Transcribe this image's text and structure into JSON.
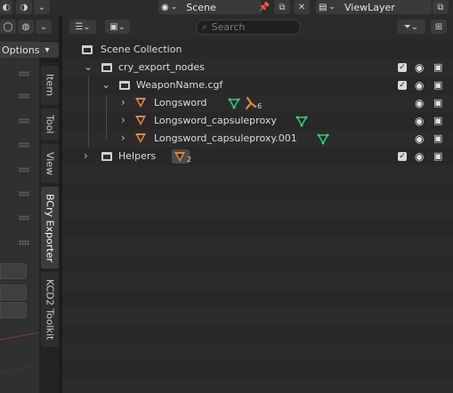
{
  "topbar": {
    "scene_label": "Scene",
    "viewlayer_label": "ViewLayer"
  },
  "viewport": {
    "options_label": "Options",
    "options_arrow": "▾"
  },
  "sidebar_tabs": [
    "Item",
    "Tool",
    "View",
    "BCry Exporter",
    "KCD2 Toolkit"
  ],
  "outliner": {
    "search_placeholder": "Search",
    "rows": [
      {
        "label": "Scene Collection"
      },
      {
        "label": "cry_export_nodes"
      },
      {
        "label": "WeaponName.cgf"
      },
      {
        "label": "Longsword",
        "badge": "6"
      },
      {
        "label": "Longsword_capsuleproxy"
      },
      {
        "label": "Longsword_capsuleproxy.001"
      },
      {
        "label": "Helpers",
        "badge": "2"
      }
    ]
  },
  "icons": {
    "expanded": "⌄",
    "collapsed": "›",
    "eye": "👁",
    "camera": "📷",
    "filter": "⛛"
  },
  "colors": {
    "mesh_orange": "#e0883a",
    "vertex_green": "#2fd07a"
  }
}
